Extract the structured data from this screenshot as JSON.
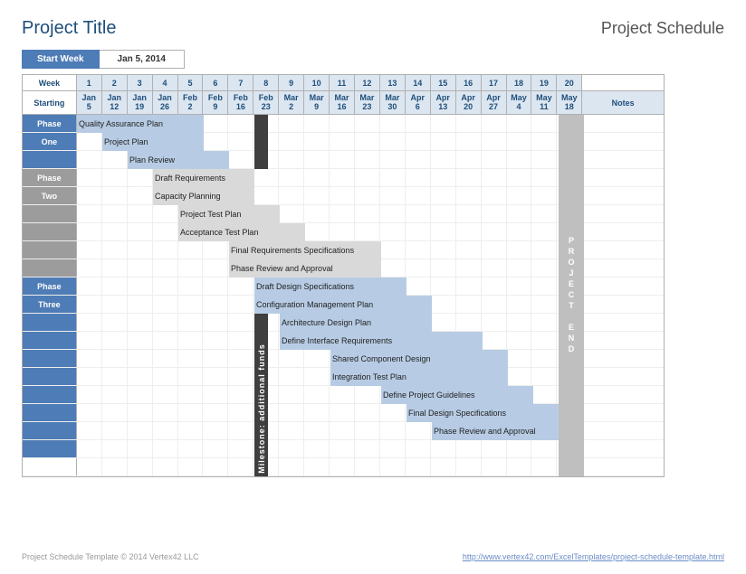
{
  "title": "Project Title",
  "subtitle": "Project Schedule",
  "start_week_label": "Start Week",
  "start_week_value": "Jan 5, 2014",
  "header": {
    "week_label": "Week",
    "starting_label": "Starting",
    "notes_label": "Notes",
    "weeks": [
      "1",
      "2",
      "3",
      "4",
      "5",
      "6",
      "7",
      "8",
      "9",
      "10",
      "11",
      "12",
      "13",
      "14",
      "15",
      "16",
      "17",
      "18",
      "19",
      "20"
    ],
    "dates": [
      {
        "mon": "Jan",
        "day": "5"
      },
      {
        "mon": "Jan",
        "day": "12"
      },
      {
        "mon": "Jan",
        "day": "19"
      },
      {
        "mon": "Jan",
        "day": "26"
      },
      {
        "mon": "Feb",
        "day": "2"
      },
      {
        "mon": "Feb",
        "day": "9"
      },
      {
        "mon": "Feb",
        "day": "16"
      },
      {
        "mon": "Feb",
        "day": "23"
      },
      {
        "mon": "Mar",
        "day": "2"
      },
      {
        "mon": "Mar",
        "day": "9"
      },
      {
        "mon": "Mar",
        "day": "16"
      },
      {
        "mon": "Mar",
        "day": "23"
      },
      {
        "mon": "Mar",
        "day": "30"
      },
      {
        "mon": "Apr",
        "day": "6"
      },
      {
        "mon": "Apr",
        "day": "13"
      },
      {
        "mon": "Apr",
        "day": "20"
      },
      {
        "mon": "Apr",
        "day": "27"
      },
      {
        "mon": "May",
        "day": "4"
      },
      {
        "mon": "May",
        "day": "11"
      },
      {
        "mon": "May",
        "day": "18"
      }
    ]
  },
  "phases": [
    {
      "name": "Phase One",
      "rows": 3,
      "style": "p1"
    },
    {
      "name": "Phase Two",
      "rows": 6,
      "style": "p2"
    },
    {
      "name": "Phase Three",
      "rows": 10,
      "style": "p3"
    }
  ],
  "milestone": {
    "label": "Milestone: additional funds",
    "col": 8
  },
  "project_end": {
    "label": "PROJECT END",
    "col": 20
  },
  "tasks": [
    {
      "name": "Quality Assurance Plan",
      "row": 0,
      "start": 1,
      "dur": 5,
      "color": "#b7cce4"
    },
    {
      "name": "Project Plan",
      "row": 1,
      "start": 2,
      "dur": 4,
      "color": "#b7cce4"
    },
    {
      "name": "Plan Review",
      "row": 2,
      "start": 3,
      "dur": 4,
      "color": "#b7cce4"
    },
    {
      "name": "Draft Requirements",
      "row": 3,
      "start": 4,
      "dur": 4,
      "color": "#d9d9d9"
    },
    {
      "name": "Capacity Planning",
      "row": 4,
      "start": 4,
      "dur": 4,
      "color": "#d9d9d9"
    },
    {
      "name": "Project Test Plan",
      "row": 5,
      "start": 5,
      "dur": 4,
      "color": "#d9d9d9"
    },
    {
      "name": "Acceptance Test Plan",
      "row": 6,
      "start": 5,
      "dur": 5,
      "color": "#d9d9d9"
    },
    {
      "name": "Final Requirements Specifications",
      "row": 7,
      "start": 7,
      "dur": 6,
      "color": "#d9d9d9"
    },
    {
      "name": "Phase Review and Approval",
      "row": 8,
      "start": 7,
      "dur": 6,
      "color": "#d9d9d9"
    },
    {
      "name": "Draft Design Specifications",
      "row": 9,
      "start": 8,
      "dur": 6,
      "color": "#b7cce4"
    },
    {
      "name": "Configuration Management Plan",
      "row": 10,
      "start": 8,
      "dur": 7,
      "color": "#b7cce4"
    },
    {
      "name": "Architecture Design Plan",
      "row": 11,
      "start": 9,
      "dur": 6,
      "color": "#b7cce4"
    },
    {
      "name": "Define Interface Requirements",
      "row": 12,
      "start": 9,
      "dur": 8,
      "color": "#b7cce4"
    },
    {
      "name": "Shared Component Design",
      "row": 13,
      "start": 11,
      "dur": 7,
      "color": "#b7cce4"
    },
    {
      "name": "Integration Test Plan",
      "row": 14,
      "start": 11,
      "dur": 7,
      "color": "#b7cce4"
    },
    {
      "name": "Define Project Guidelines",
      "row": 15,
      "start": 13,
      "dur": 6,
      "color": "#b7cce4"
    },
    {
      "name": "Final Design Specifications",
      "row": 16,
      "start": 14,
      "dur": 6,
      "color": "#b7cce4"
    },
    {
      "name": "Phase Review and Approval",
      "row": 17,
      "start": 15,
      "dur": 5,
      "color": "#b7cce4"
    }
  ],
  "footer_left": "Project Schedule Template © 2014 Vertex42 LLC",
  "footer_right": "http://www.vertex42.com/ExcelTemplates/project-schedule-template.html",
  "chart_data": {
    "type": "bar",
    "title": "Project Schedule",
    "xlabel": "Week",
    "xlim": [
      1,
      20
    ],
    "x_categories_weeks": [
      1,
      2,
      3,
      4,
      5,
      6,
      7,
      8,
      9,
      10,
      11,
      12,
      13,
      14,
      15,
      16,
      17,
      18,
      19,
      20
    ],
    "x_categories_dates": [
      "Jan 5",
      "Jan 12",
      "Jan 19",
      "Jan 26",
      "Feb 2",
      "Feb 9",
      "Feb 16",
      "Feb 23",
      "Mar 2",
      "Mar 9",
      "Mar 16",
      "Mar 23",
      "Mar 30",
      "Apr 6",
      "Apr 13",
      "Apr 20",
      "Apr 27",
      "May 4",
      "May 11",
      "May 18"
    ],
    "series": [
      {
        "name": "Quality Assurance Plan",
        "phase": "Phase One",
        "start": 1,
        "duration": 5
      },
      {
        "name": "Project Plan",
        "phase": "Phase One",
        "start": 2,
        "duration": 4
      },
      {
        "name": "Plan Review",
        "phase": "Phase One",
        "start": 3,
        "duration": 4
      },
      {
        "name": "Draft Requirements",
        "phase": "Phase Two",
        "start": 4,
        "duration": 4
      },
      {
        "name": "Capacity Planning",
        "phase": "Phase Two",
        "start": 4,
        "duration": 4
      },
      {
        "name": "Project Test Plan",
        "phase": "Phase Two",
        "start": 5,
        "duration": 4
      },
      {
        "name": "Acceptance Test Plan",
        "phase": "Phase Two",
        "start": 5,
        "duration": 5
      },
      {
        "name": "Final Requirements Specifications",
        "phase": "Phase Two",
        "start": 7,
        "duration": 6
      },
      {
        "name": "Phase Review and Approval",
        "phase": "Phase Two",
        "start": 7,
        "duration": 6
      },
      {
        "name": "Draft Design Specifications",
        "phase": "Phase Three",
        "start": 8,
        "duration": 6
      },
      {
        "name": "Configuration Management Plan",
        "phase": "Phase Three",
        "start": 8,
        "duration": 7
      },
      {
        "name": "Architecture Design Plan",
        "phase": "Phase Three",
        "start": 9,
        "duration": 6
      },
      {
        "name": "Define Interface Requirements",
        "phase": "Phase Three",
        "start": 9,
        "duration": 8
      },
      {
        "name": "Shared Component Design",
        "phase": "Phase Three",
        "start": 11,
        "duration": 7
      },
      {
        "name": "Integration Test Plan",
        "phase": "Phase Three",
        "start": 11,
        "duration": 7
      },
      {
        "name": "Define Project Guidelines",
        "phase": "Phase Three",
        "start": 13,
        "duration": 6
      },
      {
        "name": "Final Design Specifications",
        "phase": "Phase Three",
        "start": 14,
        "duration": 6
      },
      {
        "name": "Phase Review and Approval",
        "phase": "Phase Three",
        "start": 15,
        "duration": 5
      }
    ],
    "milestones": [
      {
        "name": "Milestone: additional funds",
        "week": 8
      },
      {
        "name": "Project End",
        "week": 20
      }
    ]
  }
}
